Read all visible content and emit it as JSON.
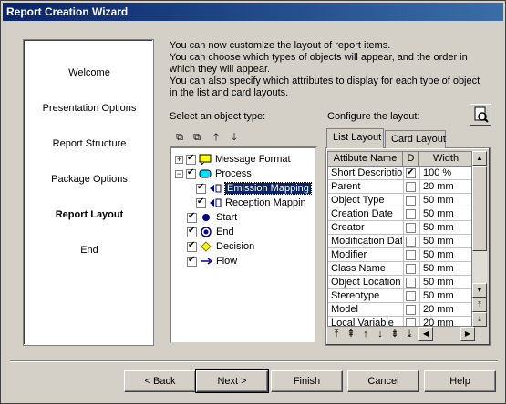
{
  "window": {
    "title": "Report Creation Wizard"
  },
  "nav": {
    "items": [
      {
        "label": "Welcome",
        "active": false
      },
      {
        "label": "Presentation Options",
        "active": false
      },
      {
        "label": "Report Structure",
        "active": false
      },
      {
        "label": "Package Options",
        "active": false
      },
      {
        "label": "Report Layout",
        "active": true
      },
      {
        "label": "End",
        "active": false
      }
    ]
  },
  "description": {
    "line1": "You can now customize the layout of report items.",
    "line2": "You can choose which types of objects will appear, and the order in which they will appear.",
    "line3": "You can also specify which attributes to display for each type of object in the list and card layouts."
  },
  "labels": {
    "select_type": "Select an object type:",
    "configure": "Configure the layout:"
  },
  "tree": {
    "items": [
      {
        "label": "Message Format",
        "icon": "message-format-icon",
        "checked": true,
        "expander": "+",
        "level": 0
      },
      {
        "label": "Process",
        "icon": "process-icon",
        "checked": true,
        "expander": "−",
        "level": 0
      },
      {
        "label": "Emission Mapping",
        "icon": "mapping-icon",
        "checked": true,
        "expander": "",
        "level": 1,
        "selected": true
      },
      {
        "label": "Reception Mappin",
        "icon": "mapping-icon",
        "checked": true,
        "expander": "",
        "level": 1
      },
      {
        "label": "Start",
        "icon": "start-icon",
        "checked": true,
        "expander": "",
        "level": 0
      },
      {
        "label": "End",
        "icon": "end-icon",
        "checked": true,
        "expander": "",
        "level": 0
      },
      {
        "label": "Decision",
        "icon": "decision-icon",
        "checked": true,
        "expander": "",
        "level": 0
      },
      {
        "label": "Flow",
        "icon": "flow-icon",
        "checked": true,
        "expander": "",
        "level": 0
      }
    ]
  },
  "tabs": {
    "list": "List Layout",
    "card": "Card Layout"
  },
  "grid": {
    "headers": {
      "name": "Attibute Name",
      "d": "D",
      "width": "Width"
    },
    "rows": [
      {
        "name": "Short Descriptio",
        "checked": true,
        "width": "100 %"
      },
      {
        "name": "Parent",
        "checked": false,
        "width": "20 mm"
      },
      {
        "name": "Object Type",
        "checked": false,
        "width": "50 mm"
      },
      {
        "name": "Creation Date",
        "checked": false,
        "width": "50 mm"
      },
      {
        "name": "Creator",
        "checked": false,
        "width": "50 mm"
      },
      {
        "name": "Modification Dat",
        "checked": false,
        "width": "50 mm"
      },
      {
        "name": "Modifier",
        "checked": false,
        "width": "50 mm"
      },
      {
        "name": "Class Name",
        "checked": false,
        "width": "50 mm"
      },
      {
        "name": "Object Location",
        "checked": false,
        "width": "50 mm"
      },
      {
        "name": "Stereotype",
        "checked": false,
        "width": "50 mm"
      },
      {
        "name": "Model",
        "checked": false,
        "width": "20 mm"
      },
      {
        "name": "Local Variable",
        "checked": false,
        "width": "20 mm"
      }
    ]
  },
  "buttons": {
    "back": "< Back",
    "next": "Next >",
    "finish": "Finish",
    "cancel": "Cancel",
    "help": "Help"
  },
  "colors": {
    "title_start": "#0a246a",
    "title_end": "#3a6ea5",
    "face": "#d4d0c8"
  }
}
